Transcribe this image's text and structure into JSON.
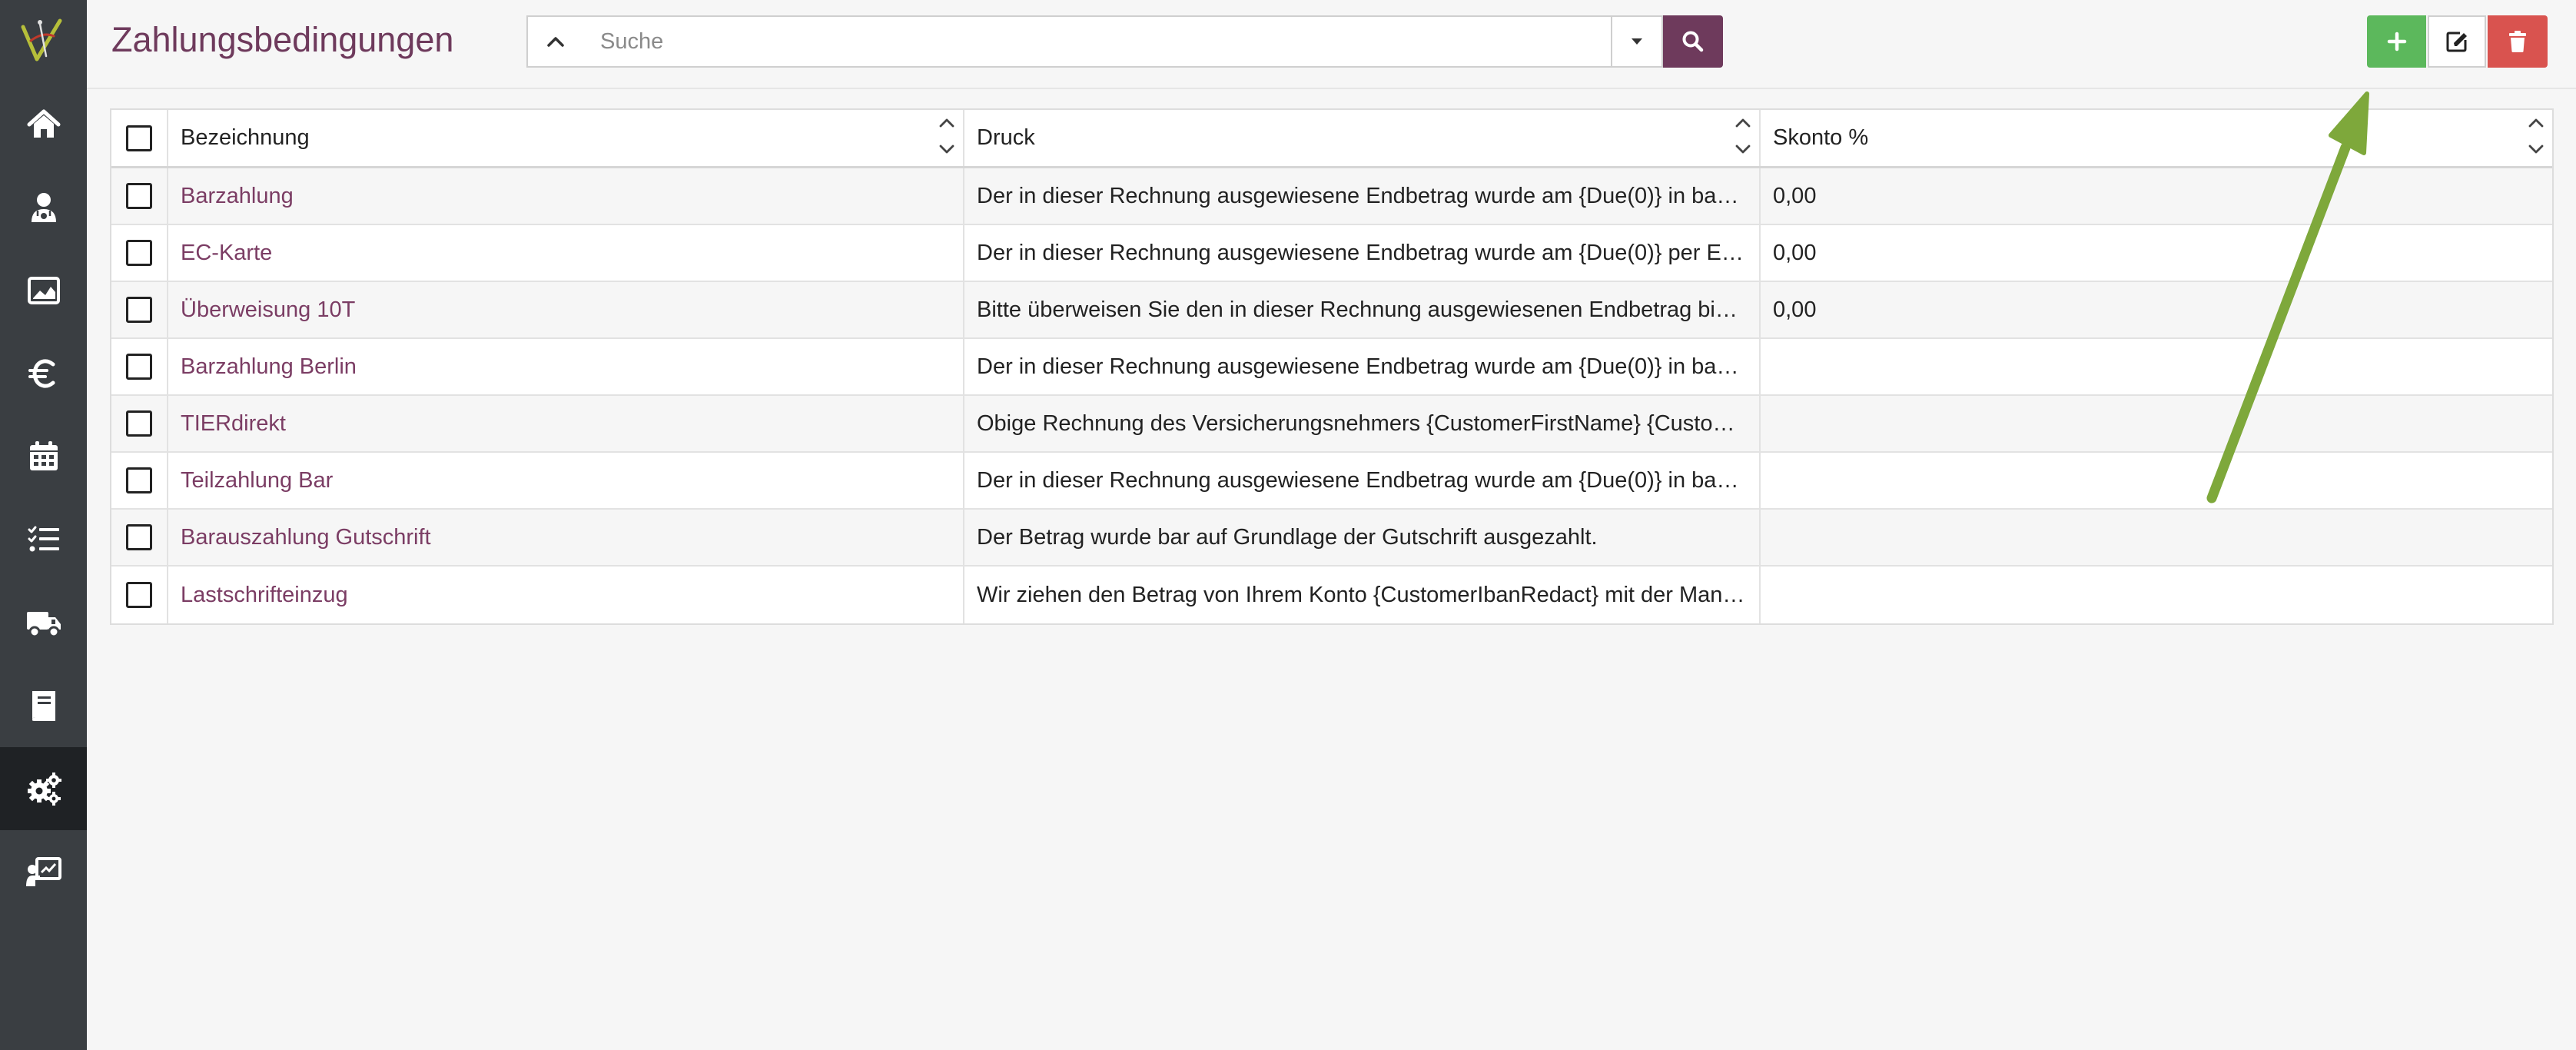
{
  "page_title": "Zahlungsbedingungen",
  "search": {
    "placeholder": "Suche",
    "value": ""
  },
  "accent_color": "#6e3a5c",
  "sidebar": {
    "items": [
      {
        "icon": "home-icon"
      },
      {
        "icon": "user-doctor-icon"
      },
      {
        "icon": "image-chart-icon"
      },
      {
        "icon": "euro-icon"
      },
      {
        "icon": "calendar-icon"
      },
      {
        "icon": "tasks-icon"
      },
      {
        "icon": "truck-icon"
      },
      {
        "icon": "book-icon"
      },
      {
        "icon": "gears-icon",
        "active": true
      },
      {
        "icon": "presentation-icon"
      }
    ]
  },
  "toolbar": {
    "add": "plus-icon",
    "edit": "edit-icon",
    "delete": "trash-icon"
  },
  "table": {
    "columns": [
      "Bezeichnung",
      "Druck",
      "Skonto %"
    ],
    "rows": [
      {
        "name": "Barzahlung",
        "print": "Der in dieser Rechnung ausgewiesene Endbetrag wurde am {Due(0)} in bar begl…",
        "skonto": "0,00"
      },
      {
        "name": "EC-Karte",
        "print": "Der in dieser Rechnung ausgewiesene Endbetrag wurde am {Due(0)} per EC-Ka…",
        "skonto": "0,00"
      },
      {
        "name": "Überweisung 10T",
        "print": "Bitte überweisen Sie den in dieser Rechnung ausgewiesenen Endbetrag bis zu…",
        "skonto": "0,00"
      },
      {
        "name": "Barzahlung Berlin",
        "print": "Der in dieser Rechnung ausgewiesene Endbetrag wurde am {Due(0)} in bar begl…",
        "skonto": ""
      },
      {
        "name": "TIERdirekt",
        "print": "Obige Rechnung des Versicherungsnehmers {CustomerFirstName} {CustomerL…",
        "skonto": ""
      },
      {
        "name": "Teilzahlung Bar",
        "print": "Der in dieser Rechnung ausgewiesene Endbetrag wurde am {Due(0)} in bar teil…",
        "skonto": ""
      },
      {
        "name": "Barauszahlung Gutschrift",
        "print": "Der Betrag wurde bar auf Grundlage der Gutschrift ausgezahlt.",
        "skonto": ""
      },
      {
        "name": "Lastschrifteinzug",
        "print": "Wir ziehen den Betrag von Ihrem Konto {CustomerIbanRedact} mit der Mandats…",
        "skonto": ""
      }
    ]
  }
}
